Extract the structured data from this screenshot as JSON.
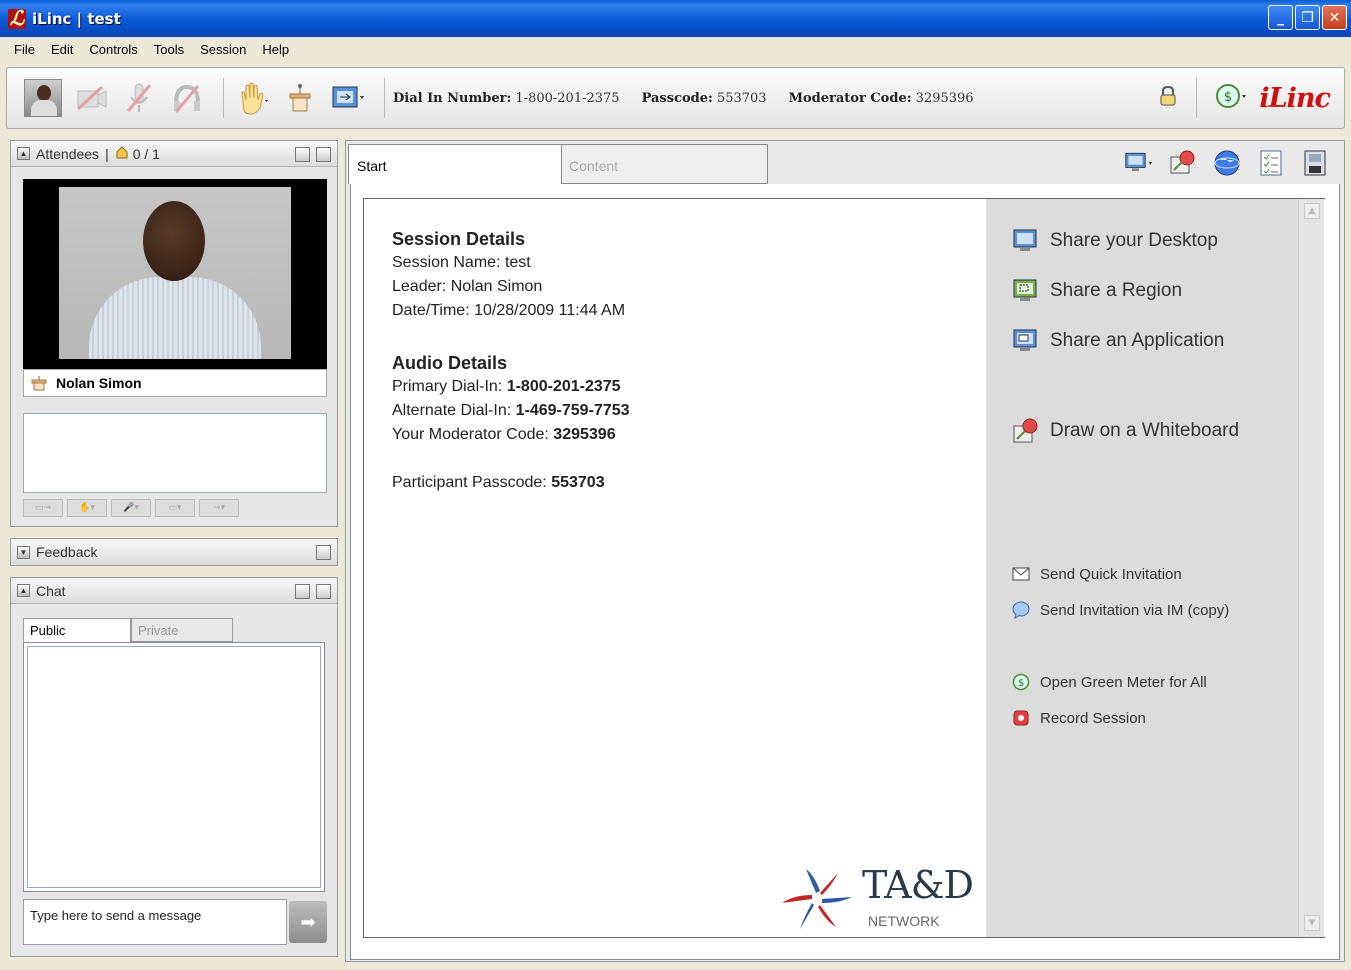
{
  "window": {
    "title": "iLinc | test"
  },
  "menu": [
    "File",
    "Edit",
    "Controls",
    "Tools",
    "Session",
    "Help"
  ],
  "toolbar": {
    "dial_label": "Dial In Number:",
    "dial_value": "1-800-201-2375",
    "passcode_label": "Passcode:",
    "passcode_value": "553703",
    "mod_label": "Moderator Code:",
    "mod_value": "3295396",
    "brand": "iLinc"
  },
  "attendees": {
    "title": "Attendees",
    "count": "0 / 1",
    "current_user": "Nolan Simon"
  },
  "feedback": {
    "title": "Feedback"
  },
  "chat": {
    "title": "Chat",
    "tabs": [
      "Public",
      "Private"
    ],
    "input_value": "Type here to send a message"
  },
  "main": {
    "tabs": [
      "Start",
      "Content"
    ],
    "session_heading": "Session Details",
    "session_name_label": "Session Name:",
    "session_name": "test",
    "leader_label": "Leader:",
    "leader": "Nolan Simon",
    "datetime_label": "Date/Time:",
    "datetime": "10/28/2009 11:44 AM",
    "audio_heading": "Audio Details",
    "primary_label": "Primary Dial-In:",
    "primary": "1-800-201-2375",
    "alternate_label": "Alternate Dial-In:",
    "alternate": "1-469-759-7753",
    "modcode_label": "Your Moderator Code:",
    "modcode": "3295396",
    "passcode_label": "Participant Passcode:",
    "passcode": "553703"
  },
  "actions": {
    "share_desktop": "Share your Desktop",
    "share_region": "Share a Region",
    "share_app": "Share an Application",
    "whiteboard": "Draw on a Whiteboard",
    "quick_invite": "Send Quick Invitation",
    "im_invite": "Send Invitation via IM (copy)",
    "green_meter": "Open Green Meter for All",
    "record": "Record Session"
  },
  "branding": {
    "tad": "TA&D",
    "network": "NETWORK"
  },
  "colors": {
    "title_bar": "#0a57d4",
    "brand_red": "#d01010",
    "action_panel": "#dcdcdc"
  }
}
